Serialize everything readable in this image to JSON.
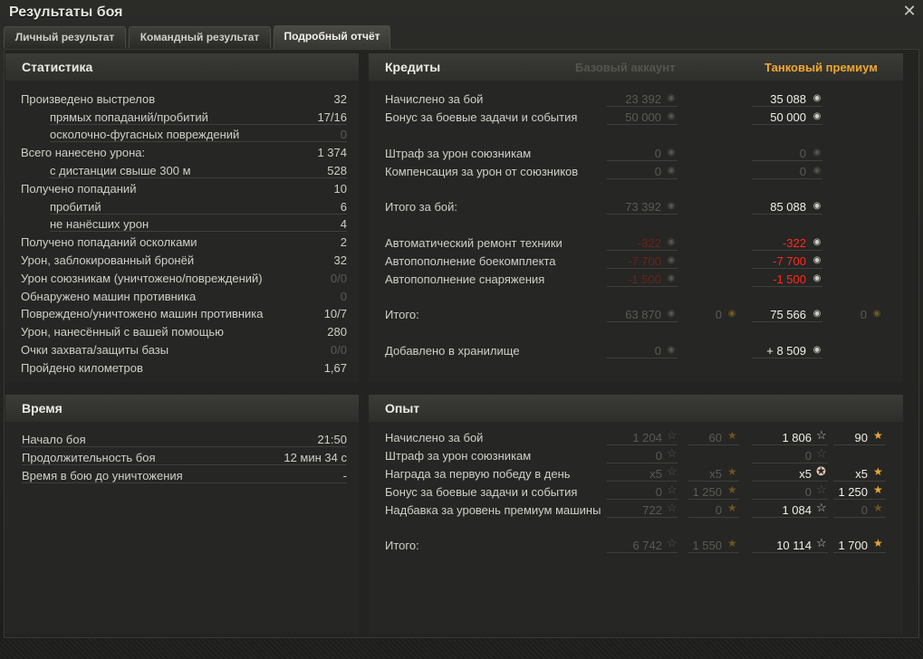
{
  "window": {
    "title": "Результаты боя"
  },
  "tabs": [
    {
      "label": "Личный результат"
    },
    {
      "label": "Командный результат"
    },
    {
      "label": "Подробный отчёт"
    }
  ],
  "stats": {
    "title": "Статистика",
    "rows": [
      {
        "label": "Произведено выстрелов",
        "value": "32"
      },
      {
        "label": "прямых попаданий/пробитий",
        "value": "17/16"
      },
      {
        "label": "осколочно-фугасных повреждений",
        "value": "0"
      },
      {
        "label": "Всего нанесено урона:",
        "value": "1 374"
      },
      {
        "label": "с дистанции свыше 300 м",
        "value": "528"
      },
      {
        "label": "Получено попаданий",
        "value": "10"
      },
      {
        "label": "пробитий",
        "value": "6"
      },
      {
        "label": "не нанёсших урон",
        "value": "4"
      },
      {
        "label": "Получено попаданий осколками",
        "value": "2"
      },
      {
        "label": "Урон, заблокированный бронёй",
        "value": "32"
      },
      {
        "label": "Урон союзникам (уничтожено/повреждений)",
        "value": "0/0"
      },
      {
        "label": "Обнаружено машин противника",
        "value": "0"
      },
      {
        "label": "Повреждено/уничтожено машин противника",
        "value": "10/7"
      },
      {
        "label": "Урон, нанесённый с вашей помощью",
        "value": "280"
      },
      {
        "label": "Очки захвата/защиты базы",
        "value": "0/0"
      },
      {
        "label": "Пройдено километров",
        "value": "1,67"
      }
    ]
  },
  "time": {
    "title": "Время",
    "rows": [
      {
        "label": "Начало боя",
        "value": "21:50"
      },
      {
        "label": "Продолжительность боя",
        "value": "12 мин 34 с"
      },
      {
        "label": "Время в бою до уничтожения",
        "value": "-"
      }
    ]
  },
  "credits": {
    "title": "Кредиты",
    "col_base": "Базовый аккаунт",
    "col_premium": "Танковый премиум",
    "premium_color": "#f0a830",
    "base_color": "#55554f",
    "rows": [
      {
        "label": "Начислено за бой",
        "base": "23 392",
        "premium": "35 088"
      },
      {
        "label": "Бонус за боевые задачи и события",
        "base": "50 000",
        "premium": "50 000"
      },
      {
        "label": "Штраф за урон союзникам",
        "base": "0",
        "premium": "0"
      },
      {
        "label": "Компенсация за урон от союзников",
        "base": "0",
        "premium": "0"
      },
      {
        "label": "Итого за бой:",
        "base": "73 392",
        "premium": "85 088"
      },
      {
        "label": "Автоматический ремонт техники",
        "base": "-322",
        "premium": "-322"
      },
      {
        "label": "Автопополнение боекомплекта",
        "base": "-7 700",
        "premium": "-7 700"
      },
      {
        "label": "Автопополнение снаряжения",
        "base": "-1 500",
        "premium": "-1 500"
      },
      {
        "label": "Итого:",
        "base": "63 870",
        "base_gold": "0",
        "premium": "75 566",
        "premium_gold": "0"
      },
      {
        "label": "Добавлено в хранилище",
        "base": "0",
        "premium": "+ 8 509"
      }
    ]
  },
  "xp": {
    "title": "Опыт",
    "rows": [
      {
        "label": "Начислено за бой",
        "base": "1 204",
        "base_free": "60",
        "premium": "1 806",
        "premium_free": "90"
      },
      {
        "label": "Штраф за урон союзникам",
        "base": "0",
        "premium": "0"
      },
      {
        "label": "Награда за первую победу в день",
        "base": "x5",
        "base_free": "x5",
        "premium": "x5",
        "premium_free": "x5"
      },
      {
        "label": "Бонус за боевые задачи и события",
        "base": "0",
        "base_free": "1 250",
        "premium": "0",
        "premium_free": "1 250"
      },
      {
        "label": "Надбавка за уровень премиум машины",
        "base": "722",
        "base_free": "0",
        "premium": "1 084",
        "premium_free": "0"
      },
      {
        "label": "Итого:",
        "base": "6 742",
        "base_free": "1 550",
        "premium": "10 114",
        "premium_free": "1 700"
      }
    ]
  },
  "icons": {
    "close": "close-icon",
    "credit": "credit-icon",
    "gold": "gold-icon",
    "xp": "xp-star-icon",
    "free_xp": "free-xp-star-icon"
  }
}
